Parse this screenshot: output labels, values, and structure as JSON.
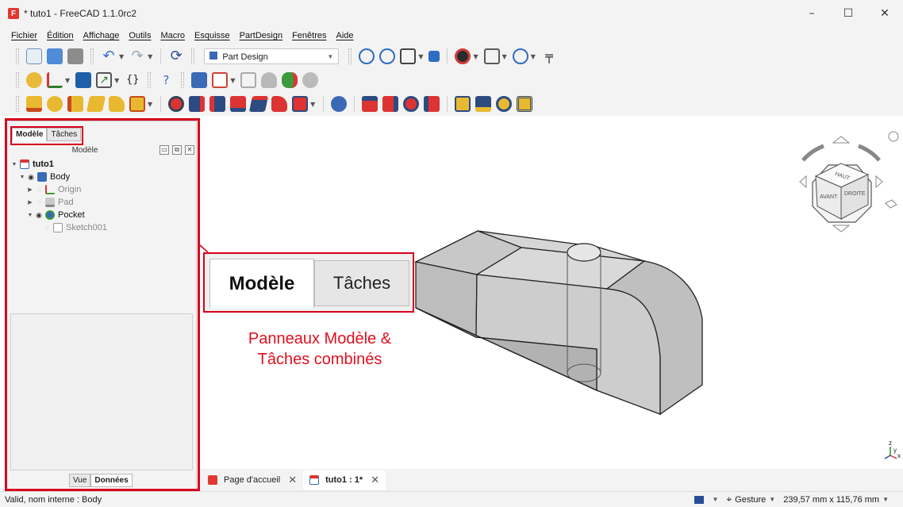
{
  "window": {
    "title": "* tuto1 - FreeCAD 1.1.0rc2",
    "controls": [
      "–",
      "☐",
      "✕"
    ]
  },
  "menu": [
    "Fichier",
    "Édition",
    "Affichage",
    "Outils",
    "Macro",
    "Esquisse",
    "PartDesign",
    "Fenêtres",
    "Aide"
  ],
  "toolbar": {
    "workbench": "Part Design"
  },
  "combo_panel": {
    "tabs": [
      "Modèle",
      "Tâches"
    ],
    "tree_header": "Modèle",
    "tree": [
      {
        "label": "tuto1"
      },
      {
        "label": "Body"
      },
      {
        "label": "Origin"
      },
      {
        "label": "Pad"
      },
      {
        "label": "Pocket"
      },
      {
        "label": "Sketch001"
      }
    ],
    "bottom_tabs": [
      "Vue",
      "Données"
    ]
  },
  "callout": {
    "tab_active": "Modèle",
    "tab_inactive": "Tâches",
    "annotation_line1": "Panneaux Modèle &",
    "annotation_line2": "Tâches combinés"
  },
  "navcube": {
    "top": "HAUT",
    "front": "AVANT",
    "right": "DROITE"
  },
  "axes": {
    "z": "z",
    "y": "y",
    "x": "x"
  },
  "doc_tabs": [
    {
      "label": "Page d'accueil",
      "close": "✕"
    },
    {
      "label": "tuto1 : 1*",
      "close": "✕"
    }
  ],
  "status": {
    "message": "Valid, nom interne : Body",
    "nav_style": "Gesture",
    "dimensions": "239,57 mm x 115,76 mm"
  },
  "colors": {
    "highlight": "#d8001c",
    "annotation": "#e0101f"
  }
}
